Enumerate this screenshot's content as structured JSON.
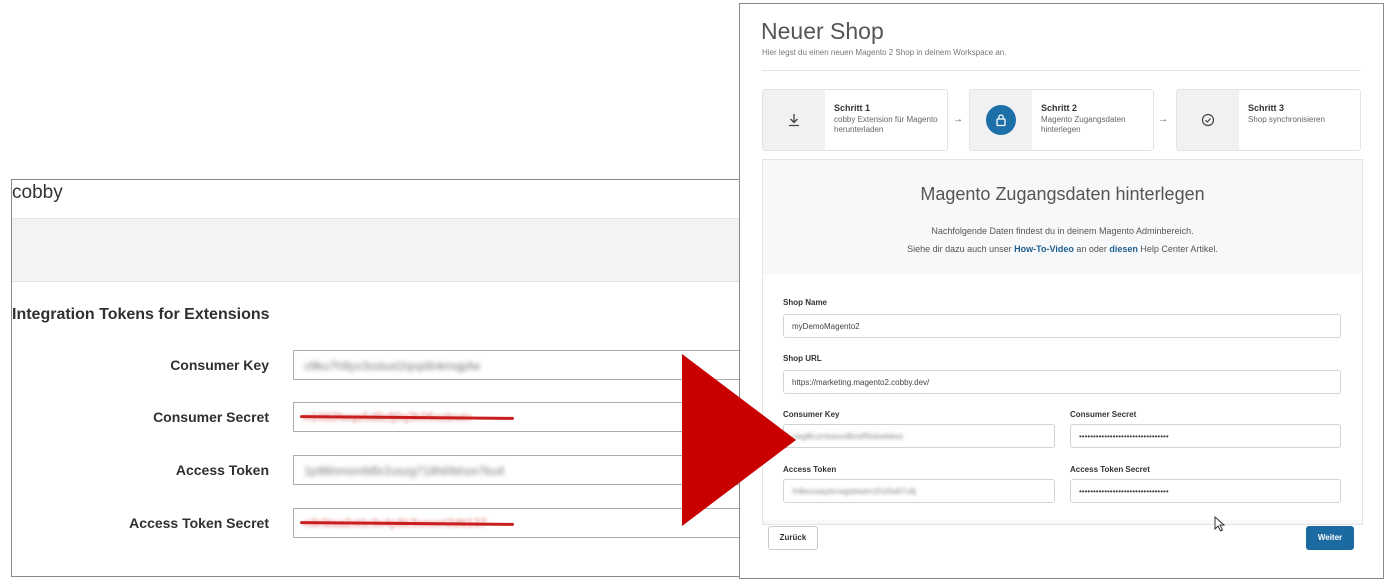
{
  "left": {
    "brand": "cobby",
    "section_title": "Integration Tokens for Extensions",
    "rows": [
      {
        "label": "Consumer Key",
        "value": "v9ku7h9yx3sstuxl2qop8nkmqpfw",
        "style": "blurred"
      },
      {
        "label": "Consumer Secret",
        "value": "n1082fwqa5d8cfj0q3k06ozbwin",
        "style": "struck"
      },
      {
        "label": "Access Token",
        "value": "1p96hmsmfd5r2uszg718hi0bhze7ku4",
        "style": "blurred"
      },
      {
        "label": "Access Token Secret",
        "value": "n3r3tsa2ot1r3x4p8k3wwxri2dtt137",
        "style": "struck"
      }
    ]
  },
  "right": {
    "title": "Neuer Shop",
    "subtitle": "Hier legst du einen neuen Magento 2 Shop in deinem Workspace an.",
    "steps": [
      {
        "title": "Schritt 1",
        "desc": "cobby Extension für Magento herunterladen",
        "icon": "download-icon"
      },
      {
        "title": "Schritt 2",
        "desc": "Magento Zugangsdaten hinterlegen",
        "icon": "lock-icon"
      },
      {
        "title": "Schritt 3",
        "desc": "Shop synchronisieren",
        "icon": "check-circle-icon"
      }
    ],
    "step_arrow": "→",
    "card": {
      "heading": "Magento Zugangsdaten hinterlegen",
      "line1": "Nachfolgende Daten findest du in deinem Magento Adminbereich.",
      "line2_a": "Siehe dir dazu auch unser ",
      "line2_link1": "How-To-Video",
      "line2_b": " an oder ",
      "line2_link2": "diesen",
      "line2_c": " Help Center Artikel."
    },
    "fields": {
      "shop_name_label": "Shop Name",
      "shop_name_value": "myDemoMagento2",
      "shop_url_label": "Shop URL",
      "shop_url_value": "https://marketing.magento2.cobby.dev/",
      "consumer_key_label": "Consumer Key",
      "consumer_key_value": "cwg8iczmtsexol8xstf5kdxeblesi",
      "consumer_secret_label": "Consumer Secret",
      "consumer_secret_value": "••••••••••••••••••••••••••••••••",
      "access_token_label": "Access Token",
      "access_token_value": "rh8esxwqzkcwgsbtwtrn2h26a97uftj",
      "access_token_secret_label": "Access Token Secret",
      "access_token_secret_value": "••••••••••••••••••••••••••••••••"
    },
    "buttons": {
      "back": "Zurück",
      "next": "Weiter"
    },
    "colors": {
      "primary": "#1b6aa1",
      "arrow": "#c80000"
    }
  }
}
